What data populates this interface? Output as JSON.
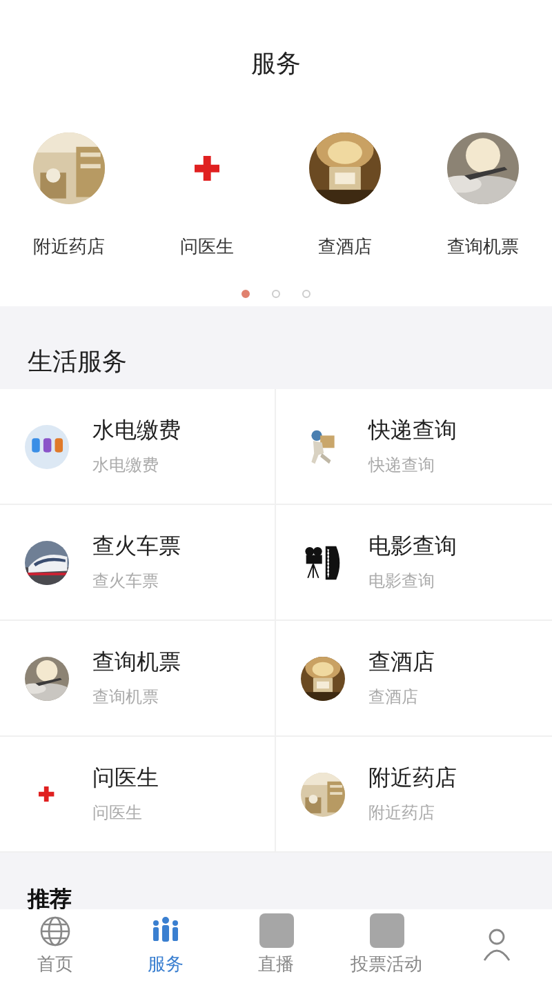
{
  "title": "服务",
  "carousel": {
    "items": [
      {
        "label": "附近药店",
        "kind": "pharmacy"
      },
      {
        "label": "问医生",
        "kind": "cross"
      },
      {
        "label": "查酒店",
        "kind": "hotel"
      },
      {
        "label": "查询机票",
        "kind": "plane"
      }
    ],
    "pages": [
      {
        "selected": true
      },
      {
        "selected": false
      },
      {
        "selected": false
      }
    ]
  },
  "life_services": {
    "title": "生活服务",
    "items": [
      {
        "name": "水电缴费",
        "subtitle": "水电缴费",
        "kind": "bills"
      },
      {
        "name": "快递查询",
        "subtitle": "快递查询",
        "kind": "courier"
      },
      {
        "name": "查火车票",
        "subtitle": "查火车票",
        "kind": "train"
      },
      {
        "name": "电影查询",
        "subtitle": "电影查询",
        "kind": "camera"
      },
      {
        "name": "查询机票",
        "subtitle": "查询机票",
        "kind": "plane"
      },
      {
        "name": "查酒店",
        "subtitle": "查酒店",
        "kind": "hotel"
      },
      {
        "name": "问医生",
        "subtitle": "问医生",
        "kind": "cross"
      },
      {
        "name": "附近药店",
        "subtitle": "附近药店",
        "kind": "pharmacy"
      }
    ]
  },
  "recommend": {
    "title": "推荐"
  },
  "tab_bar": [
    {
      "label": "首页",
      "kind": "globe",
      "selected": false
    },
    {
      "label": "服务",
      "kind": "people",
      "selected": true
    },
    {
      "label": "直播",
      "kind": "square",
      "selected": false
    },
    {
      "label": "投票活动",
      "kind": "square",
      "selected": false
    },
    {
      "kind": "person",
      "selected": false
    }
  ]
}
